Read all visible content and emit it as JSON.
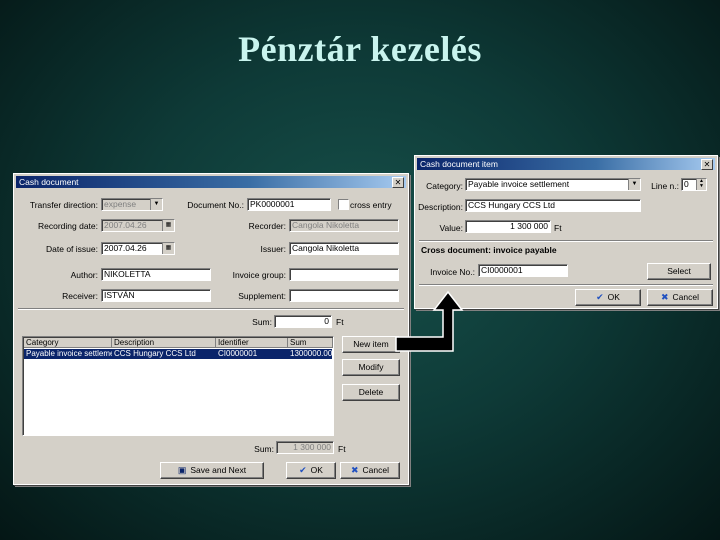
{
  "slide": {
    "title": "Pénztár kezelés"
  },
  "cash_document": {
    "title": "Cash document",
    "close": "✕",
    "labels": {
      "transfer_direction": "Transfer direction:",
      "document_no": "Document No.:",
      "cross_entry": "cross entry",
      "recording_date": "Recording date:",
      "recorder": "Recorder:",
      "date_of_issue": "Date of issue:",
      "issuer": "Issuer:",
      "author": "Author:",
      "invoice_group": "Invoice group:",
      "receiver": "Receiver:",
      "supplement": "Supplement:",
      "sum": "Sum:",
      "sum_bottom": "Sum:",
      "currency": "Ft",
      "currency_bottom": "Ft"
    },
    "values": {
      "transfer_direction": "expense",
      "document_no": "PK0000001",
      "recording_date": "2007.04.26",
      "recorder": "Cangola Nikoletta",
      "date_of_issue": "2007.04.26",
      "issuer": "Cangola Nikoletta",
      "author": "NIKOLETTA",
      "invoice_group": "",
      "receiver": "ISTVÁN",
      "supplement": "",
      "sum_top": "0",
      "sum_bottom": "1 300 000"
    },
    "grid": {
      "columns": [
        "Category",
        "Description",
        "Identifier",
        "Sum"
      ],
      "rows": [
        {
          "category": "Payable invoice settlement",
          "description": "CCS Hungary CCS Ltd",
          "identifier": "CI0000001",
          "sum": "1300000.00"
        }
      ]
    },
    "buttons": {
      "new_item": "New item",
      "modify": "Modify",
      "delete": "Delete",
      "save_and_next": "Save and Next",
      "ok": "OK",
      "cancel": "Cancel"
    }
  },
  "cash_item": {
    "title": "Cash document item",
    "close": "✕",
    "labels": {
      "category": "Category:",
      "line_no": "Line n.:",
      "description": "Description:",
      "value": "Value:",
      "currency": "Ft",
      "cross_section": "Cross document: invoice payable",
      "invoice_no": "Invoice No.:"
    },
    "values": {
      "category": "Payable invoice settlement",
      "line_no": "0",
      "description": "CCS Hungary CCS Ltd",
      "value": "1 300 000",
      "invoice_no": "CI0000001"
    },
    "buttons": {
      "select": "Select",
      "ok": "OK",
      "cancel": "Cancel"
    }
  },
  "colors": {
    "titlebar": "#0a246a",
    "window_face": "#d4d0c8",
    "slide_title": "#c9f4ee",
    "background": "#0e3a37"
  }
}
